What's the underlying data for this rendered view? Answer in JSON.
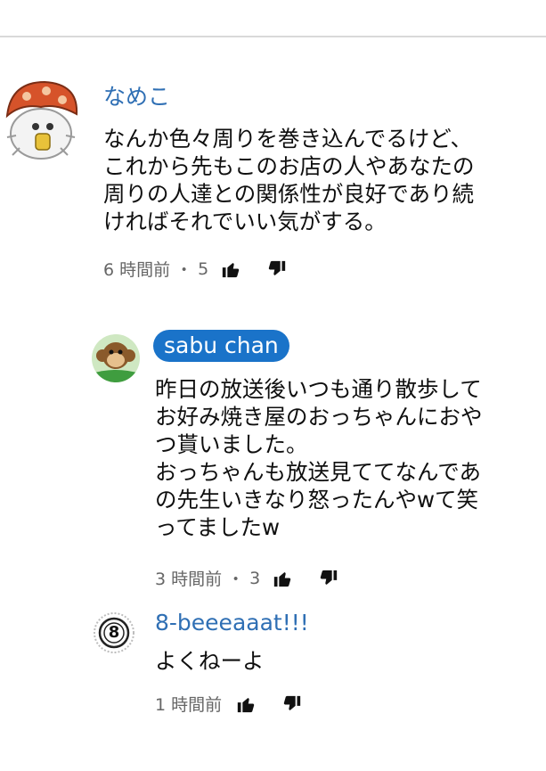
{
  "comments": [
    {
      "author": "なめこ",
      "lines": [
        "なんか色々周りを巻き込んでるけど、",
        "これから先もこのお店の人やあなたの",
        "周りの人達との関係性が良好であり続",
        "ければそれでいい気がする。"
      ],
      "time": "6 時間前",
      "separator": "・",
      "likes": "5"
    }
  ],
  "replies": [
    {
      "author": "sabu chan",
      "lines": [
        "昨日の放送後いつも通り散歩して",
        "お好み焼き屋のおっちゃんにおや",
        "つ貰いました。",
        "おっちゃんも放送見ててなんであ",
        "の先生いきなり怒ったんやwて笑",
        "ってましたw"
      ],
      "time": "3 時間前",
      "separator": "・",
      "likes": "3"
    },
    {
      "author": "8-beeeaaat!!!",
      "avatar_text": "8",
      "lines": [
        "よくねーよ"
      ],
      "time": "1 時間前"
    }
  ],
  "colors": {
    "link": "#2f6fb4",
    "pill": "#1a73c9",
    "meta": "#666666",
    "divider": "#d9d9d9"
  },
  "icons": {
    "like": "thumbs-up-icon",
    "dislike": "thumbs-down-icon"
  }
}
